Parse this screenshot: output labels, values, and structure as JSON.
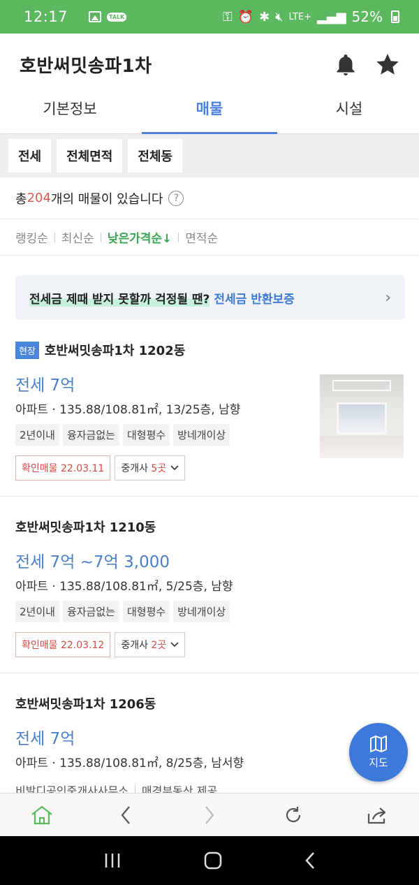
{
  "status_bar": {
    "time": "12:17",
    "talk_label": "TALK",
    "network": "LTE+",
    "battery": "52%"
  },
  "header": {
    "title": "호반써밋송파1차",
    "icons": [
      "bell-icon",
      "star-icon"
    ]
  },
  "tabs": [
    {
      "label": "기본정보",
      "active": false
    },
    {
      "label": "매물",
      "active": true
    },
    {
      "label": "시설",
      "active": false
    }
  ],
  "filters": [
    "전세",
    "전체면적",
    "전체동"
  ],
  "count": {
    "prefix": "총 ",
    "number": "204",
    "suffix": "개의 매물이 있습니다",
    "help": "?"
  },
  "sort": {
    "items": [
      "랭킹순",
      "최신순",
      "낮은가격순↓",
      "면적순"
    ],
    "active_index": 2
  },
  "banner": {
    "text": "전세금 제때 받지 못할까 걱정될 땐?",
    "link": "전세금 반환보증",
    "chevron": "›"
  },
  "listings": [
    {
      "badge": "현장",
      "title": "호반써밋송파1차 1202동",
      "price_type": "전세",
      "price": "7억",
      "spec": "아파트 · 135.88/108.81㎡, 13/25층, 남향",
      "tags": [
        "2년이내",
        "융자금없는",
        "대형평수",
        "방네개이상"
      ],
      "confirm": "확인매물 22.03.11",
      "agents_prefix": "중개사 ",
      "agents_count": "5곳",
      "has_photo": true
    },
    {
      "badge": "",
      "title": "호반써밋송파1차 1210동",
      "price_type": "전세",
      "price": "7억 ~7억 3,000",
      "spec": "아파트 · 135.88/108.81㎡, 5/25층, 남향",
      "tags": [
        "2년이내",
        "융자금없는",
        "대형평수",
        "방네개이상"
      ],
      "confirm": "확인매물 22.03.12",
      "agents_prefix": "중개사 ",
      "agents_count": "2곳",
      "has_photo": false
    },
    {
      "badge": "",
      "title": "호반써밋송파1차 1206동",
      "price_type": "전세",
      "price": "7억",
      "spec": "아파트 · 135.88/108.81㎡, 8/25층, 남서향",
      "agency": "비발디공인중개사사무소",
      "provider": "매경부동산 제공"
    }
  ],
  "fab": {
    "label": "지도",
    "icon": "map-icon"
  },
  "bottom_nav": [
    "home-icon",
    "back-icon",
    "forward-icon",
    "refresh-icon",
    "share-icon"
  ],
  "colors": {
    "status_green": "#5cb85f",
    "accent_blue": "#4a7fdc",
    "sort_green": "#3aa553",
    "red": "#d34a43"
  }
}
